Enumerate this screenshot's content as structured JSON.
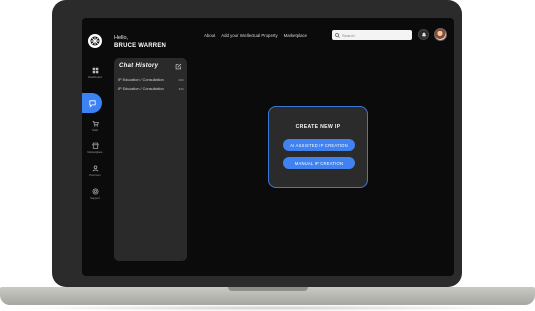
{
  "header": {
    "greeting": "Hello,",
    "user_name": "BRUCE WARREN",
    "nav": [
      "About",
      "Add your Intellectual Property",
      "Marketplace"
    ],
    "search_placeholder": "Search"
  },
  "sidebar": {
    "items": [
      {
        "label": "Dashboard",
        "icon": "grid-icon"
      },
      {
        "label": "",
        "icon": "chat-icon",
        "active": true
      },
      {
        "label": "Sells",
        "icon": "cart-icon"
      },
      {
        "label": "Marketplace",
        "icon": "store-icon"
      },
      {
        "label": "Post Item",
        "icon": "user-icon"
      },
      {
        "label": "Support",
        "icon": "support-icon"
      }
    ]
  },
  "chat_history": {
    "title": "Chat History",
    "items": [
      "IP Education / Consultation",
      "IP Education / Consultation"
    ]
  },
  "create_ip": {
    "title": "CREATE NEW IP",
    "ai_button": "AI ASSISTED IP CREATION",
    "manual_button": "MANUAL IP CREATION"
  },
  "colors": {
    "accent": "#3f82f0",
    "panel": "#2a2a2a",
    "background": "#0b0b0b"
  }
}
